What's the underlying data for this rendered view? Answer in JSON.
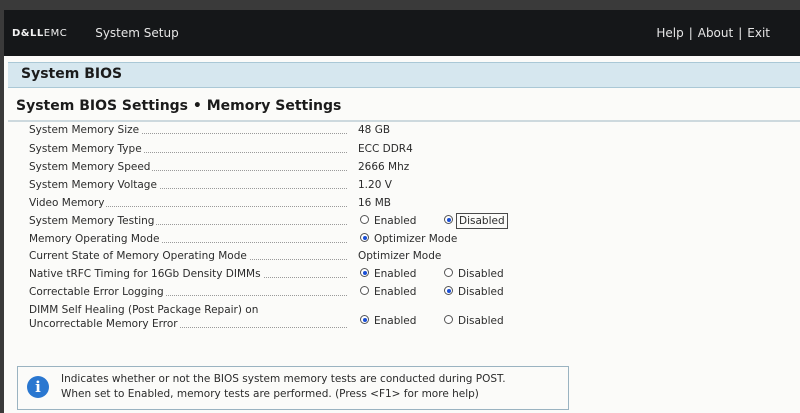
{
  "header": {
    "brand_bold": "D&LL",
    "brand_thin": "EMC",
    "title": "System Setup",
    "links": [
      "Help",
      "About",
      "Exit"
    ],
    "separator": "|"
  },
  "section": {
    "title": "System BIOS"
  },
  "page": {
    "breadcrumb": "System BIOS Settings • Memory Settings"
  },
  "settings": [
    {
      "label": "System Memory Size",
      "value": "48 GB"
    },
    {
      "label": "System Memory Type",
      "value": "ECC DDR4"
    },
    {
      "label": "System Memory Speed",
      "value": "2666 Mhz"
    },
    {
      "label": "System Memory Voltage",
      "value": "1.20 V"
    },
    {
      "label": "Video Memory",
      "value": "16 MB"
    },
    {
      "label": "System Memory Testing",
      "options": [
        "Enabled",
        "Disabled"
      ],
      "selected": "Disabled"
    },
    {
      "label": "Memory Operating Mode",
      "options": [
        "Optimizer Mode"
      ],
      "selected": "Optimizer Mode"
    },
    {
      "label": "Current State of Memory Operating Mode",
      "value": "Optimizer Mode"
    },
    {
      "label": "Native tRFC Timing for 16Gb Density DIMMs",
      "options": [
        "Enabled",
        "Disabled"
      ],
      "selected": "Enabled"
    },
    {
      "label": "Correctable Error Logging",
      "options": [
        "Enabled",
        "Disabled"
      ],
      "selected": "Disabled"
    },
    {
      "label_line1": "DIMM Self Healing (Post Package Repair) on",
      "label_line2": "Uncorrectable Memory Error",
      "options": [
        "Enabled",
        "Disabled"
      ],
      "selected": "Enabled"
    }
  ],
  "help": {
    "icon": "info-icon",
    "line1": "Indicates whether or not the BIOS system memory tests are conducted during POST.",
    "line2": "When set to Enabled, memory tests are performed. (Press <F1> for more help)"
  }
}
